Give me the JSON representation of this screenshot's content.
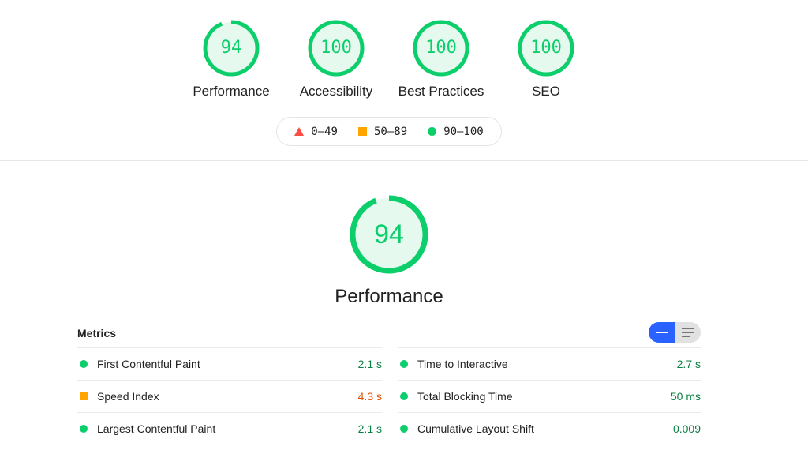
{
  "summary": {
    "gauges": [
      {
        "label": "Performance",
        "score": "94",
        "fraction": 0.94
      },
      {
        "label": "Accessibility",
        "score": "100",
        "fraction": 1.0
      },
      {
        "label": "Best Practices",
        "score": "100",
        "fraction": 1.0
      },
      {
        "label": "SEO",
        "score": "100",
        "fraction": 1.0
      }
    ],
    "legend": [
      {
        "shape": "triangle",
        "range": "0–49",
        "color": "#ff4e42"
      },
      {
        "shape": "square",
        "range": "50–89",
        "color": "#ffa400"
      },
      {
        "shape": "circle",
        "range": "90–100",
        "color": "#0cce6b"
      }
    ]
  },
  "category": {
    "label": "Performance",
    "score": "94",
    "fraction": 0.94
  },
  "metrics": {
    "title": "Metrics",
    "toggle": {
      "active": "summary-view",
      "inactive": "detail-view"
    },
    "left": [
      {
        "name": "First Contentful Paint",
        "value": "2.1 s",
        "rating": "pass"
      },
      {
        "name": "Speed Index",
        "value": "4.3 s",
        "rating": "average"
      },
      {
        "name": "Largest Contentful Paint",
        "value": "2.1 s",
        "rating": "pass"
      }
    ],
    "right": [
      {
        "name": "Time to Interactive",
        "value": "2.7 s",
        "rating": "pass"
      },
      {
        "name": "Total Blocking Time",
        "value": "50 ms",
        "rating": "pass"
      },
      {
        "name": "Cumulative Layout Shift",
        "value": "0.009",
        "rating": "pass"
      }
    ]
  },
  "colors": {
    "pass": "#0cce6b",
    "pass_text": "#0b8043",
    "average": "#ffa400",
    "average_text": "#e65100",
    "fail": "#ff4e42",
    "gauge_fill": "#e6f9ef",
    "toggle_active": "#2962ff"
  }
}
